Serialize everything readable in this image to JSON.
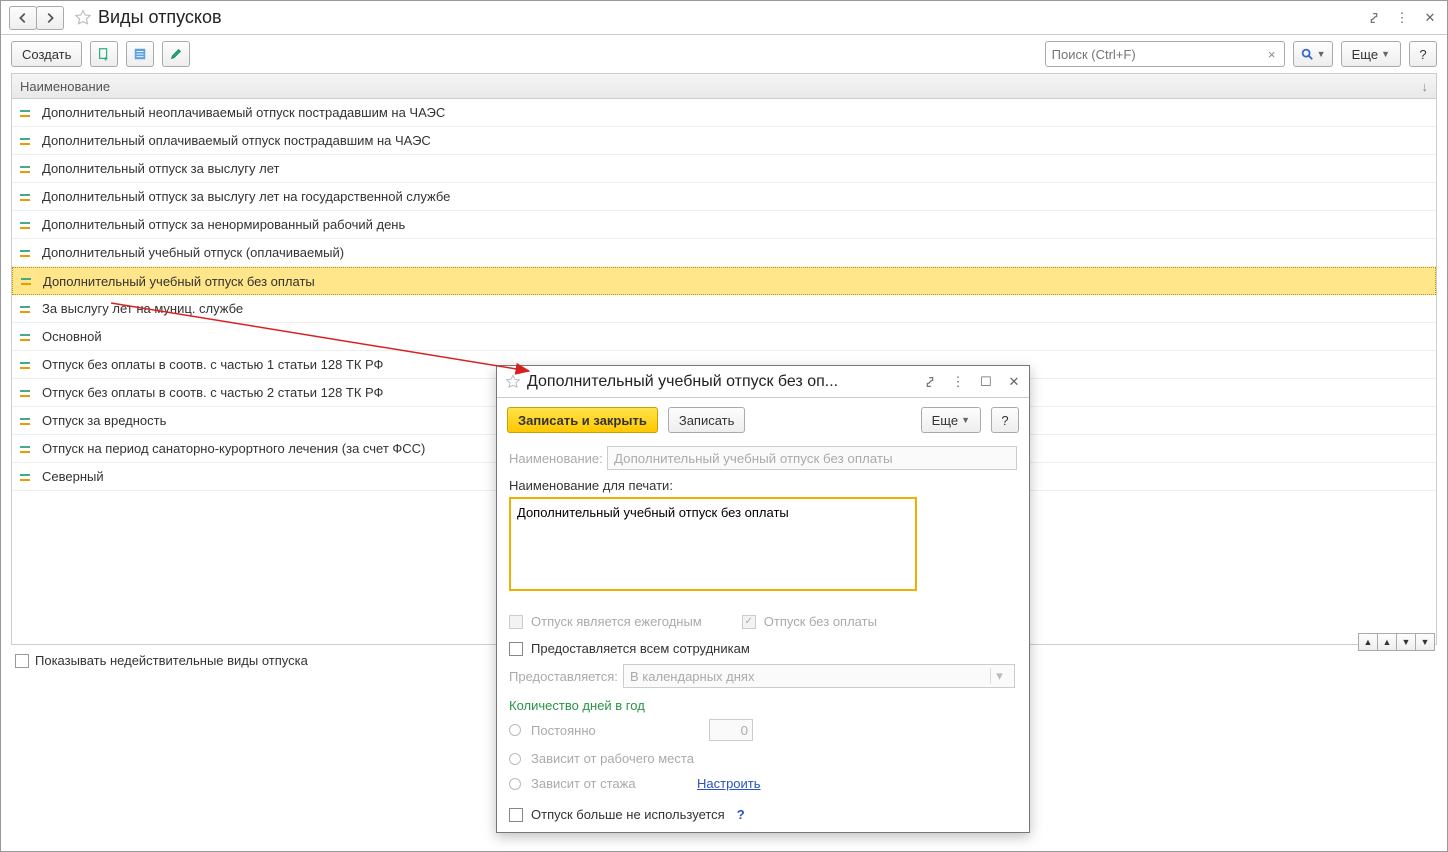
{
  "title": "Виды отпусков",
  "toolbar": {
    "create": "Создать",
    "more": "Еще",
    "search_placeholder": "Поиск (Ctrl+F)"
  },
  "grid": {
    "header": "Наименование",
    "rows": [
      "Дополнительный неоплачиваемый отпуск пострадавшим на ЧАЭС",
      "Дополнительный оплачиваемый отпуск пострадавшим на ЧАЭС",
      "Дополнительный отпуск за выслугу лет",
      "Дополнительный отпуск за выслугу лет на государственной службе",
      "Дополнительный отпуск за ненормированный рабочий день",
      "Дополнительный учебный отпуск (оплачиваемый)",
      "Дополнительный учебный отпуск без оплаты",
      "За выслугу лет на муниц. службе",
      "Основной",
      "Отпуск без оплаты в соотв. с частью 1 статьи 128 ТК РФ",
      "Отпуск без оплаты в соотв. с частью 2 статьи 128 ТК РФ",
      "Отпуск за вредность",
      "Отпуск на период санаторно-курортного лечения (за счет ФСС)",
      "Северный"
    ],
    "selected_index": 6
  },
  "footer": {
    "show_inactive": "Показывать недействительные виды отпуска"
  },
  "dialog": {
    "title": "Дополнительный учебный отпуск без оп...",
    "save_close": "Записать и закрыть",
    "save": "Записать",
    "more": "Еще",
    "name_label": "Наименование:",
    "name_value": "Дополнительный учебный отпуск без оплаты",
    "print_label": "Наименование для печати:",
    "print_value": "Дополнительный учебный отпуск без оплаты",
    "annual": "Отпуск является ежегодным",
    "unpaid": "Отпуск без оплаты",
    "all_employees": "Предоставляется всем сотрудникам",
    "provided_label": "Предоставляется:",
    "provided_value": "В календарных днях",
    "days_section": "Количество дней в год",
    "opt_const": "Постоянно",
    "opt_const_value": "0",
    "opt_workplace": "Зависит от рабочего места",
    "opt_tenure": "Зависит от стажа",
    "configure": "Настроить",
    "no_longer_used": "Отпуск больше не используется"
  }
}
